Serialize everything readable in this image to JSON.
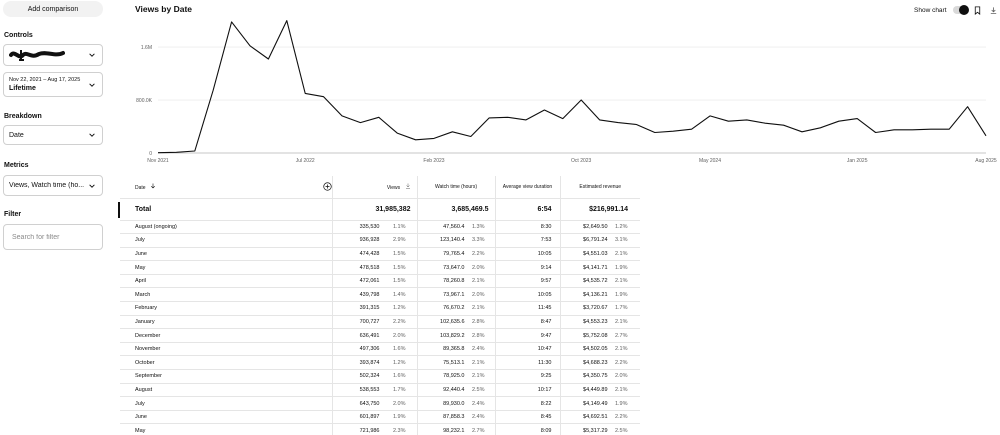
{
  "sidebar": {
    "add_comparison": "Add comparison",
    "controls_label": "Controls",
    "date_range_small": "Nov 22, 2021 – Aug 17, 2025",
    "date_range_big": "Lifetime",
    "breakdown_label": "Breakdown",
    "breakdown_value": "Date",
    "metrics_label": "Metrics",
    "metrics_value": "Views, Watch time (ho...",
    "filter_label": "Filter",
    "filter_placeholder": "Search for filter"
  },
  "header": {
    "title": "Views by Date",
    "show_chart": "Show chart"
  },
  "chart_data": {
    "type": "line",
    "series_color": "#0f0f0f",
    "y_ticks": [
      {
        "value": 0,
        "label": "0"
      },
      {
        "value": 800000,
        "label": "800.0K"
      },
      {
        "value": 1600000,
        "label": "1.6M"
      }
    ],
    "ylim": [
      0,
      2100000
    ],
    "x_ticks": [
      {
        "index": 0,
        "label": "Nov 2021"
      },
      {
        "index": 8,
        "label": "Jul 2022"
      },
      {
        "index": 15,
        "label": "Feb 2023"
      },
      {
        "index": 23,
        "label": "Oct 2023"
      },
      {
        "index": 30,
        "label": "May 2024"
      },
      {
        "index": 38,
        "label": "Jan 2025"
      },
      {
        "index": 45,
        "label": "Aug 2025"
      }
    ],
    "values": [
      5000,
      10000,
      30000,
      950000,
      1980000,
      1620000,
      1420000,
      2000000,
      900000,
      850000,
      560000,
      460000,
      540000,
      300000,
      200000,
      220000,
      320000,
      250000,
      530000,
      540000,
      500000,
      650000,
      520000,
      800000,
      500000,
      460000,
      430000,
      310000,
      330000,
      360000,
      560000,
      480000,
      500000,
      450000,
      420000,
      320000,
      380000,
      480000,
      520000,
      310000,
      350000,
      350000,
      360000,
      360000,
      700000,
      260000
    ]
  },
  "table": {
    "headers": {
      "date": "Date",
      "views": "Views",
      "watch_time": "Watch time (hours)",
      "avg_duration": "Average view duration",
      "revenue": "Estimated revenue"
    },
    "total": {
      "label": "Total",
      "views": "31,985,382",
      "watch_time": "3,685,469.5",
      "avg_duration": "6:54",
      "revenue": "$216,991.14"
    },
    "rows": [
      {
        "date": "August (ongoing)",
        "views": "335,530",
        "views_pct": "1.1%",
        "watch": "47,560.4",
        "watch_pct": "1.3%",
        "dur": "8:30",
        "rev": "$2,649.50",
        "rev_pct": "1.2%"
      },
      {
        "date": "July",
        "views": "936,928",
        "views_pct": "2.9%",
        "watch": "123,140.4",
        "watch_pct": "3.3%",
        "dur": "7:53",
        "rev": "$6,791.24",
        "rev_pct": "3.1%"
      },
      {
        "date": "June",
        "views": "474,428",
        "views_pct": "1.5%",
        "watch": "79,765.4",
        "watch_pct": "2.2%",
        "dur": "10:05",
        "rev": "$4,551.03",
        "rev_pct": "2.1%"
      },
      {
        "date": "May",
        "views": "478,518",
        "views_pct": "1.5%",
        "watch": "73,647.0",
        "watch_pct": "2.0%",
        "dur": "9:14",
        "rev": "$4,141.71",
        "rev_pct": "1.9%"
      },
      {
        "date": "April",
        "views": "472,061",
        "views_pct": "1.5%",
        "watch": "78,260.8",
        "watch_pct": "2.1%",
        "dur": "9:57",
        "rev": "$4,535.72",
        "rev_pct": "2.1%"
      },
      {
        "date": "March",
        "views": "439,798",
        "views_pct": "1.4%",
        "watch": "73,967.1",
        "watch_pct": "2.0%",
        "dur": "10:05",
        "rev": "$4,136.21",
        "rev_pct": "1.9%"
      },
      {
        "date": "February",
        "views": "391,315",
        "views_pct": "1.2%",
        "watch": "76,670.2",
        "watch_pct": "2.1%",
        "dur": "11:45",
        "rev": "$3,720.67",
        "rev_pct": "1.7%"
      },
      {
        "date": "January",
        "views": "700,727",
        "views_pct": "2.2%",
        "watch": "102,635.6",
        "watch_pct": "2.8%",
        "dur": "8:47",
        "rev": "$4,553.23",
        "rev_pct": "2.1%"
      },
      {
        "date": "December",
        "views": "636,491",
        "views_pct": "2.0%",
        "watch": "103,829.2",
        "watch_pct": "2.8%",
        "dur": "9:47",
        "rev": "$5,752.08",
        "rev_pct": "2.7%"
      },
      {
        "date": "November",
        "views": "497,306",
        "views_pct": "1.6%",
        "watch": "89,365.8",
        "watch_pct": "2.4%",
        "dur": "10:47",
        "rev": "$4,502.05",
        "rev_pct": "2.1%"
      },
      {
        "date": "October",
        "views": "393,874",
        "views_pct": "1.2%",
        "watch": "75,513.1",
        "watch_pct": "2.1%",
        "dur": "11:30",
        "rev": "$4,688.23",
        "rev_pct": "2.2%"
      },
      {
        "date": "September",
        "views": "502,324",
        "views_pct": "1.6%",
        "watch": "78,925.0",
        "watch_pct": "2.1%",
        "dur": "9:25",
        "rev": "$4,350.75",
        "rev_pct": "2.0%"
      },
      {
        "date": "August",
        "views": "538,553",
        "views_pct": "1.7%",
        "watch": "92,440.4",
        "watch_pct": "2.5%",
        "dur": "10:17",
        "rev": "$4,449.89",
        "rev_pct": "2.1%"
      },
      {
        "date": "July",
        "views": "643,750",
        "views_pct": "2.0%",
        "watch": "89,930.0",
        "watch_pct": "2.4%",
        "dur": "8:22",
        "rev": "$4,149.49",
        "rev_pct": "1.9%"
      },
      {
        "date": "June",
        "views": "601,897",
        "views_pct": "1.9%",
        "watch": "87,858.3",
        "watch_pct": "2.4%",
        "dur": "8:45",
        "rev": "$4,692.51",
        "rev_pct": "2.2%"
      },
      {
        "date": "May",
        "views": "721,986",
        "views_pct": "2.3%",
        "watch": "98,232.1",
        "watch_pct": "2.7%",
        "dur": "8:09",
        "rev": "$5,317.29",
        "rev_pct": "2.5%"
      }
    ]
  }
}
